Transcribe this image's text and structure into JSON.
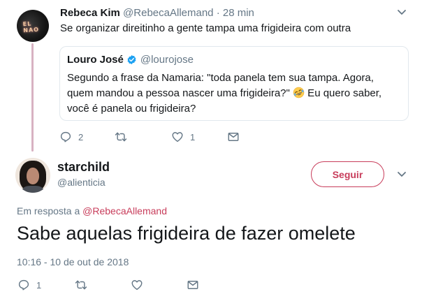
{
  "tweet1": {
    "name": "Rebeca Kim",
    "handle": "@RebecaAllemand",
    "separator": "·",
    "time": "28 min",
    "text": "Se organizar direitinho a gente tampa uma frigideira com outra",
    "avatar_sign": "EL NAO",
    "quote": {
      "name": "Louro José",
      "handle": "@lourojose",
      "text_before_emoji": "Segundo a frase da Namaria: \"toda panela tem sua tampa. Agora, quem mandou a pessoa nascer uma frigideira?\" ",
      "emoji": "rolling-on-floor-laughing-emoji",
      "text_after_emoji": " Eu quero saber, você é panela ou frigideira?"
    },
    "actions": {
      "reply_count": "2",
      "retweet_count": "",
      "like_count": "1"
    }
  },
  "tweet2": {
    "name": "starchild",
    "handle": "@alienticia",
    "follow_label": "Seguir",
    "reply_prefix": "Em resposta a",
    "reply_to": "@RebecaAllemand",
    "text": "Sabe aquelas frigideira de fazer omelete",
    "timestamp": "10:16 - 10 de out de 2018",
    "actions": {
      "reply_count": "1",
      "retweet_count": "",
      "like_count": ""
    }
  },
  "colors": {
    "accent": "#c83d5b",
    "text_secondary": "#657786",
    "verified": "#1da1f2",
    "thread_line": "#d8b2c2"
  }
}
